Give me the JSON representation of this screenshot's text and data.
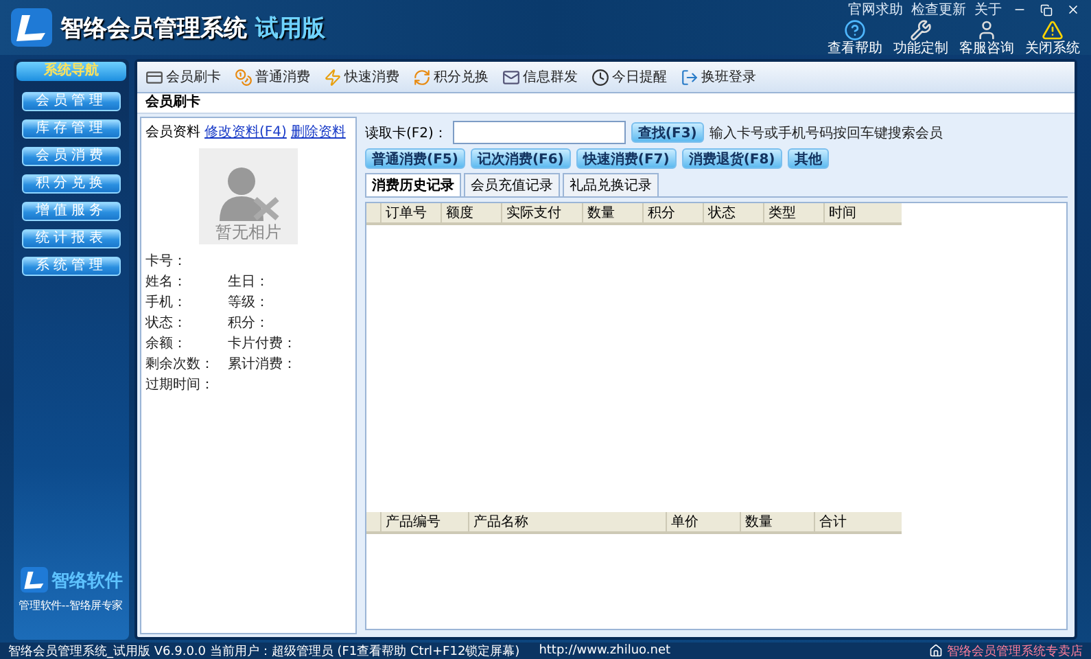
{
  "window": {
    "title": "智络会员管理系统",
    "edition": "试用版",
    "links": [
      "官网求助",
      "检查更新",
      "关于"
    ]
  },
  "header_tools": [
    {
      "label": "查看帮助",
      "kind": "help"
    },
    {
      "label": "功能定制",
      "kind": "tools"
    },
    {
      "label": "客服咨询",
      "kind": "service"
    },
    {
      "label": "关闭系统",
      "kind": "warning"
    }
  ],
  "sidebar": {
    "title": "系统导航",
    "items": [
      "会员管理",
      "库存管理",
      "会员消费",
      "积分兑换",
      "增值服务",
      "统计报表",
      "系统管理"
    ],
    "brand": "智络软件",
    "slogan": "管理软件--智络屏专家"
  },
  "toolbar": [
    {
      "label": "会员刷卡",
      "kind": "card"
    },
    {
      "label": "普通消费",
      "kind": "coins"
    },
    {
      "label": "快速消费",
      "kind": "fast"
    },
    {
      "label": "积分兑换",
      "kind": "exchange"
    },
    {
      "label": "信息群发",
      "kind": "mail"
    },
    {
      "label": "今日提醒",
      "kind": "clock"
    },
    {
      "label": "换班登录",
      "kind": "logout"
    }
  ],
  "panel_title": "会员刷卡",
  "member": {
    "legend": "会员资料",
    "actions": [
      "修改资料(F4)",
      "删除资料"
    ],
    "photo_caption": "暂无相片",
    "rows": [
      [
        "卡号："
      ],
      [
        "姓名：",
        "生日："
      ],
      [
        "手机：",
        "等级："
      ],
      [
        "状态：",
        "积分："
      ],
      [
        "余额：",
        "卡片付费："
      ],
      [
        "剩余次数：",
        "累计消费："
      ],
      [
        "过期时间："
      ]
    ]
  },
  "search": {
    "label": "读取卡(F2)：",
    "button": "查找(F3)",
    "hint": "输入卡号或手机号码按回车键搜索会员"
  },
  "actions": [
    "普通消费(F5)",
    "记次消费(F6)",
    "快速消费(F7)",
    "消费退货(F8)",
    "其他"
  ],
  "tabs": [
    {
      "label": "消费历史记录",
      "selected": true
    },
    {
      "label": "会员充值记录",
      "selected": false
    },
    {
      "label": "礼品兑换记录",
      "selected": false
    }
  ],
  "history_table": {
    "columns": [
      "订单号",
      "额度",
      "实际支付",
      "数量",
      "积分",
      "状态",
      "类型",
      "时间"
    ]
  },
  "product_table": {
    "columns": [
      "产品编号",
      "产品名称",
      "单价",
      "数量",
      "合计"
    ]
  },
  "status_bar": {
    "text": "智络会员管理系统_试用版 V6.9.0.0 当前用户：超级管理员 (F1查看帮助 Ctrl+F12锁定屏幕)",
    "url": "http://www.zhiluo.net",
    "right": "智络会员管理系统专卖店"
  }
}
